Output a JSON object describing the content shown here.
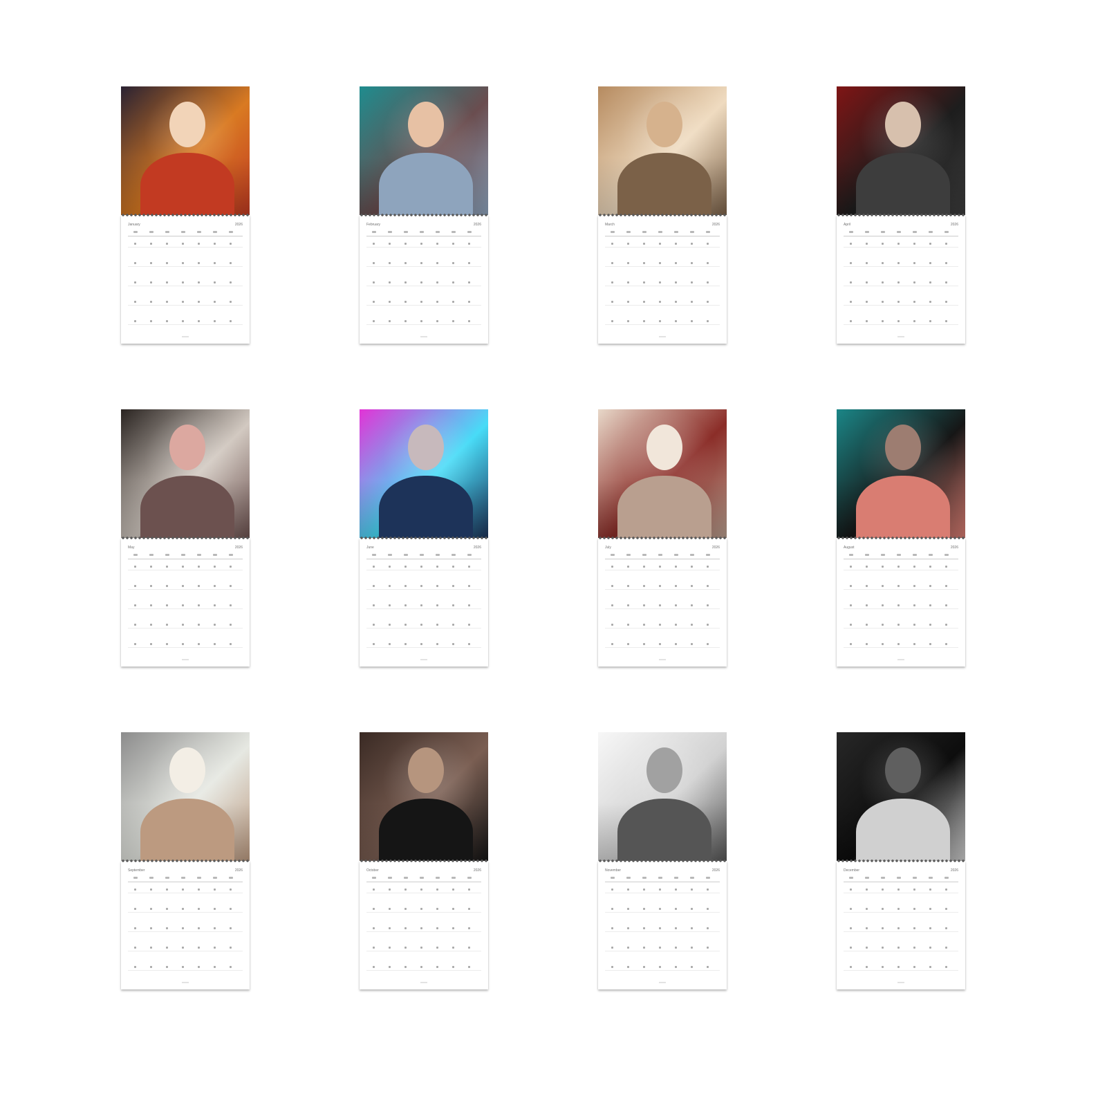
{
  "calendar": {
    "year": "2026",
    "months": [
      {
        "name": "January",
        "palette": [
          "#2a2232",
          "#d97a22",
          "#c23a22",
          "#f2d4b8"
        ]
      },
      {
        "name": "February",
        "palette": [
          "#1f8c8e",
          "#6a4d4f",
          "#8ea4bd",
          "#e7c1a4"
        ]
      },
      {
        "name": "March",
        "palette": [
          "#b68b60",
          "#efdbc0",
          "#7b6148",
          "#d6b28d"
        ]
      },
      {
        "name": "April",
        "palette": [
          "#7f1515",
          "#1d1d1d",
          "#3d3d3d",
          "#d7c0ad"
        ]
      },
      {
        "name": "May",
        "palette": [
          "#2a2421",
          "#d2c9c1",
          "#6c514f",
          "#dca8a0"
        ]
      },
      {
        "name": "June",
        "palette": [
          "#e233d6",
          "#48dbf7",
          "#1d3359",
          "#c7b9bc"
        ]
      },
      {
        "name": "July",
        "palette": [
          "#e8d8c9",
          "#8b2d28",
          "#b99f8f",
          "#f1e6da"
        ]
      },
      {
        "name": "August",
        "palette": [
          "#1b8687",
          "#161616",
          "#d97d72",
          "#9d7d71"
        ]
      },
      {
        "name": "September",
        "palette": [
          "#8c8c8c",
          "#e6e8e2",
          "#bc9a80",
          "#f3eee5"
        ]
      },
      {
        "name": "October",
        "palette": [
          "#3a2a24",
          "#7a5e52",
          "#151515",
          "#b6957e"
        ]
      },
      {
        "name": "November",
        "palette": [
          "#f7f7f7",
          "#d2d2d2",
          "#555555",
          "#a1a1a1"
        ]
      },
      {
        "name": "December",
        "palette": [
          "#272727",
          "#0d0d0d",
          "#d0d0d0",
          "#5f5f5f"
        ]
      }
    ]
  }
}
